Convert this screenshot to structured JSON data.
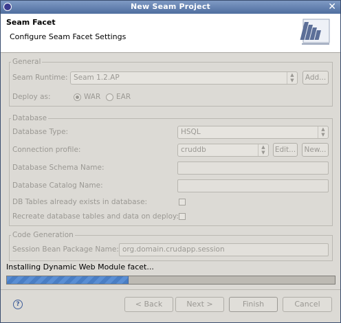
{
  "window": {
    "title": "New Seam Project"
  },
  "banner": {
    "title": "Seam Facet",
    "description": "Configure Seam Facet Settings"
  },
  "general": {
    "legend": "General",
    "runtime_label": "Seam Runtime:",
    "runtime_value": "Seam 1.2.AP",
    "add_label": "Add...",
    "deploy_label": "Deploy as:",
    "war_label": "WAR",
    "ear_label": "EAR",
    "deploy_selected": "WAR"
  },
  "database": {
    "legend": "Database",
    "type_label": "Database Type:",
    "type_value": "HSQL",
    "profile_label": "Connection profile:",
    "profile_value": "cruddb",
    "edit_label": "Edit...",
    "new_label": "New...",
    "schema_label": "Database Schema Name:",
    "schema_value": "",
    "catalog_label": "Database Catalog Name:",
    "catalog_value": "",
    "tables_exist_label": "DB Tables already exists in database:",
    "tables_exist_checked": false,
    "recreate_label": "Recreate database tables and data on deploy:",
    "recreate_checked": false
  },
  "codegen": {
    "legend": "Code Generation",
    "session_bean_label": "Session Bean Package Name:",
    "session_bean_value": "org.domain.crudapp.session"
  },
  "progress": {
    "status": "Installing Dynamic Web Module facet...",
    "fraction": 0.37
  },
  "footer": {
    "back": "< Back",
    "next": "Next >",
    "finish": "Finish",
    "cancel": "Cancel",
    "help_glyph": "?"
  },
  "colors": {
    "titlebar": "#4f6e9f",
    "progress_fill": "#5b8fd4",
    "disabled_text": "#9a9893"
  }
}
